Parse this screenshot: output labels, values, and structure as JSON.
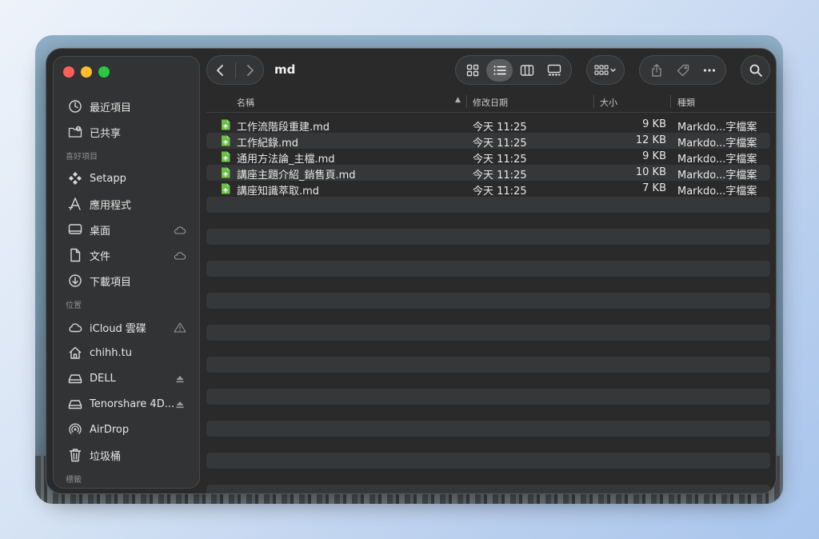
{
  "window": {
    "folder_title": "md"
  },
  "sidebar": {
    "sections": [
      {
        "label": "",
        "items": [
          {
            "label": "最近項目",
            "icon": "clock-icon"
          },
          {
            "label": "已共享",
            "icon": "shared-folder-icon"
          }
        ]
      },
      {
        "label": "喜好項目",
        "items": [
          {
            "label": "Setapp",
            "icon": "setapp-icon"
          },
          {
            "label": "應用程式",
            "icon": "applications-icon"
          },
          {
            "label": "桌面",
            "icon": "desktop-icon",
            "trail": "icloud-icon"
          },
          {
            "label": "文件",
            "icon": "document-icon",
            "trail": "icloud-icon"
          },
          {
            "label": "下載項目",
            "icon": "download-icon"
          }
        ]
      },
      {
        "label": "位置",
        "items": [
          {
            "label": "iCloud 雲碟",
            "icon": "cloud-icon",
            "trail": "warning-icon"
          },
          {
            "label": "chihh.tu",
            "icon": "home-icon"
          },
          {
            "label": "DELL",
            "icon": "drive-icon",
            "trail": "eject-icon"
          },
          {
            "label": "Tenorshare 4D...",
            "icon": "drive-icon",
            "trail": "eject-icon"
          },
          {
            "label": "AirDrop",
            "icon": "airdrop-icon"
          },
          {
            "label": "垃圾桶",
            "icon": "trash-icon"
          }
        ]
      },
      {
        "label": "標籤",
        "items": []
      }
    ]
  },
  "columns": {
    "name": "名稱",
    "date": "修改日期",
    "size": "大小",
    "kind": "種類"
  },
  "files": [
    {
      "name": "工作流階段重建.md",
      "date": "今天 11:25",
      "size": "9 KB",
      "kind": "Markdo...字檔案"
    },
    {
      "name": "工作紀錄.md",
      "date": "今天 11:25",
      "size": "12 KB",
      "kind": "Markdo...字檔案"
    },
    {
      "name": "通用方法論_主檔.md",
      "date": "今天 11:25",
      "size": "9 KB",
      "kind": "Markdo...字檔案"
    },
    {
      "name": "講座主題介紹_銷售頁.md",
      "date": "今天 11:25",
      "size": "10 KB",
      "kind": "Markdo...字檔案"
    },
    {
      "name": "講座知識萃取.md",
      "date": "今天 11:25",
      "size": "7 KB",
      "kind": "Markdo...字檔案"
    }
  ],
  "empty_rows": 19,
  "colors": {
    "window_bg": "#2a2a2b",
    "sidebar_bg": "#323334",
    "file_icon_green": "#6cc04a",
    "close": "#fe5f57",
    "minimize": "#febc2e",
    "zoom": "#28c840"
  }
}
